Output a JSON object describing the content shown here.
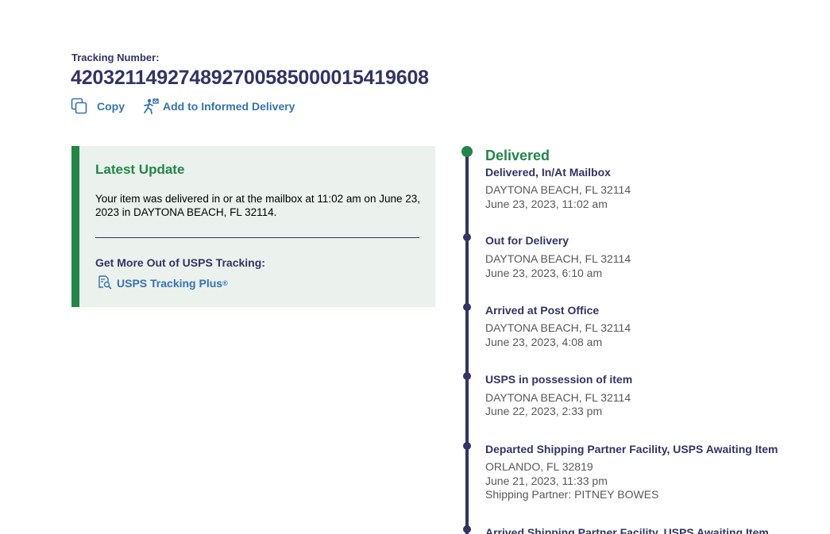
{
  "header": {
    "tracking_label": "Tracking Number:",
    "tracking_number": "420321149274892700585000015419608",
    "copy_label": "Copy",
    "informed_delivery_label": "Add to Informed Delivery"
  },
  "latest_update": {
    "title": "Latest Update",
    "text": "Your item was delivered in or at the mailbox at 11:02 am on June 23, 2023 in DAYTONA BEACH, FL 32114.",
    "more_label": "Get More Out of USPS Tracking:",
    "tracking_plus_label": "USPS Tracking Plus",
    "tracking_plus_mark": "®"
  },
  "colors": {
    "navy": "#333366",
    "green": "#218748",
    "link_blue": "#3573b1",
    "card_bg": "#ebf1ec"
  },
  "timeline": {
    "headline": "Delivered",
    "events": [
      {
        "status": "Delivered, In/At Mailbox",
        "location": "DAYTONA BEACH, FL 32114",
        "datetime": "June 23, 2023, 11:02 am"
      },
      {
        "status": "Out for Delivery",
        "location": "DAYTONA BEACH, FL 32114",
        "datetime": "June 23, 2023, 6:10 am"
      },
      {
        "status": "Arrived at Post Office",
        "location": "DAYTONA BEACH, FL 32114",
        "datetime": "June 23, 2023, 4:08 am"
      },
      {
        "status": "USPS in possession of item",
        "location": "DAYTONA BEACH, FL 32114",
        "datetime": "June 22, 2023, 2:33 pm"
      },
      {
        "status": "Departed Shipping Partner Facility, USPS Awaiting Item",
        "location": "ORLANDO, FL 32819",
        "datetime": "June 21, 2023, 11:33 pm",
        "note": "Shipping Partner: PITNEY BOWES"
      },
      {
        "status": "Arrived Shipping Partner Facility, USPS Awaiting Item"
      }
    ]
  }
}
